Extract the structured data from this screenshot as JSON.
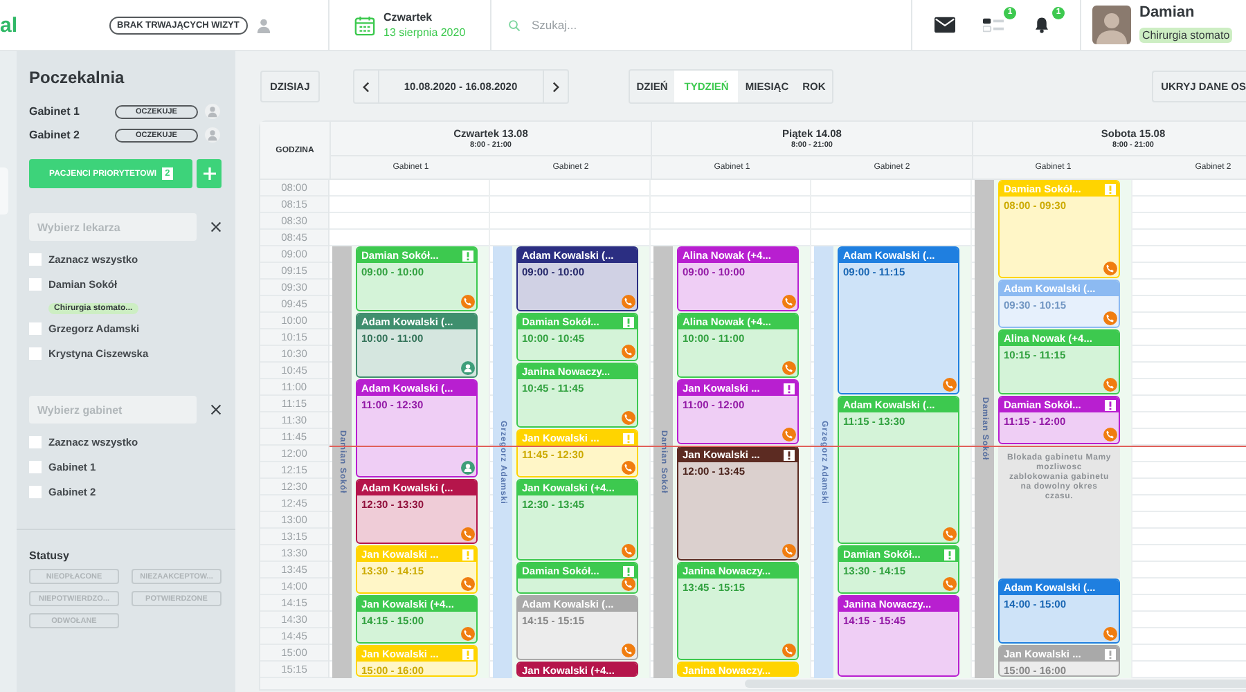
{
  "topbar": {
    "logo": "al",
    "visit_status": "BRAK TRWAJĄCYCH WIZYT",
    "weekday": "Czwartek",
    "date": "13 sierpnia 2020",
    "search": {
      "placeholder": "Szukaj..."
    },
    "tasks_badge": "1",
    "notifications_badge": "1",
    "user": {
      "name": "Damian",
      "specialty": "Chirurgia stomato"
    }
  },
  "sidebar": {
    "title": "Poczekalnia",
    "waiting": [
      {
        "room": "Gabinet 1",
        "status": "OCZEKUJE"
      },
      {
        "room": "Gabinet 2",
        "status": "OCZEKUJE"
      }
    ],
    "priority_button": {
      "label": "PACJENCI PRIORYTETOWI",
      "count": "2"
    },
    "doctor_filter": {
      "placeholder": "Wybierz lekarza",
      "options": [
        {
          "label": "Zaznacz wszystko",
          "checked": false
        },
        {
          "label": "Damian Sokół",
          "tag": "Chirurgia stomato...",
          "checked": false
        },
        {
          "label": "Grzegorz Adamski",
          "checked": false
        },
        {
          "label": "Krystyna Ciszewska",
          "checked": false
        }
      ]
    },
    "room_filter": {
      "placeholder": "Wybierz gabinet",
      "options": [
        {
          "label": "Zaznacz wszystko",
          "checked": false
        },
        {
          "label": "Gabinet 1",
          "checked": false
        },
        {
          "label": "Gabinet 2",
          "checked": false
        }
      ]
    },
    "statuses_title": "Statusy",
    "statuses": [
      {
        "label": "NIEOPŁACONE",
        "selected": false
      },
      {
        "label": "NIEZAAKCEPTOW...",
        "selected": false
      },
      {
        "label": "NIEPOTWIERDZO...",
        "selected": false
      },
      {
        "label": "POTWIERDZONE",
        "selected": false
      },
      {
        "label": "ODWOŁANE",
        "selected": false
      }
    ]
  },
  "toolbar": {
    "today": "DZISIAJ",
    "range": "10.08.2020 - 16.08.2020",
    "views": [
      {
        "label": "DZIEŃ",
        "selected": false
      },
      {
        "label": "TYDZIEŃ",
        "selected": true
      },
      {
        "label": "MIESIĄC",
        "selected": false
      },
      {
        "label": "ROK",
        "selected": false
      }
    ],
    "hide_button": "UKRYJ DANE OS"
  },
  "calendar": {
    "time_heading": "GODZINA",
    "times": [
      "08:00",
      "08:15",
      "08:30",
      "08:45",
      "09:00",
      "09:15",
      "09:30",
      "09:45",
      "10:00",
      "10:15",
      "10:30",
      "10:45",
      "11:00",
      "11:15",
      "11:30",
      "11:45",
      "12:00",
      "12:15",
      "12:30",
      "12:45",
      "13:00",
      "13:15",
      "13:30",
      "13:45",
      "14:00",
      "14:15",
      "14:30",
      "14:45",
      "15:00",
      "15:15"
    ],
    "days": [
      {
        "title": "Czwartek 13.08",
        "hours": "8:00 - 21:00",
        "rooms": [
          {
            "label": "Gabinet 1",
            "doctor": "Damian Sokół",
            "color": "#c4c4c4",
            "events": [
              {
                "kind": "phone",
                "patient": "Damian Sokół...",
                "time": "09:00 - 10:00",
                "color": "#3dc94f",
                "flag": true
              },
              {
                "kind": "person",
                "patient": "Adam Kowalski (...",
                "time": "10:00 - 11:00",
                "color": "#3f8f6e",
                "flag": false
              },
              {
                "kind": "person",
                "patient": "Adam Kowalski (...",
                "time": "11:00 - 12:30",
                "color": "#b81fd0",
                "flag": false
              },
              {
                "kind": "phone",
                "patient": "Adam Kowalski (...",
                "time": "12:30 - 13:30",
                "color": "#b5154b",
                "flag": false
              },
              {
                "kind": "phone",
                "patient": "Jan Kowalski ...",
                "time": "13:30 - 14:15",
                "color": "#ffd400",
                "flag": true
              },
              {
                "kind": "phone",
                "patient": "Jan Kowalski (+4...",
                "time": "14:15 - 15:00",
                "color": "#3dc94f",
                "flag": false
              },
              {
                "kind": "plain",
                "patient": "Jan Kowalski ...",
                "time": "15:00 - 16:00",
                "color": "#ffd400",
                "flag": true
              }
            ]
          },
          {
            "label": "Gabinet 2",
            "doctor": "Grzegorz Adamski",
            "color": "#cde1f7",
            "events": [
              {
                "kind": "phone",
                "patient": "Adam Kowalski (...",
                "time": "09:00 - 10:00",
                "color": "#2b2e82",
                "flag": false
              },
              {
                "kind": "phone",
                "patient": "Damian Sokół...",
                "time": "10:00 - 10:45",
                "color": "#3dc94f",
                "flag": true
              },
              {
                "kind": "phone",
                "patient": "Janina Nowaczy...",
                "time": "10:45 - 11:45",
                "color": "#3dc94f",
                "flag": false
              },
              {
                "kind": "phone",
                "patient": "Jan Kowalski ...",
                "time": "11:45 - 12:30",
                "color": "#ffd400",
                "flag": true
              },
              {
                "kind": "phone",
                "patient": "Jan Kowalski (+4...",
                "time": "12:30 - 13:45",
                "color": "#3dc94f",
                "flag": false
              },
              {
                "kind": "phone",
                "patient": "Damian Sokół...",
                "color": "#3dc94f",
                "flag": true
              },
              {
                "kind": "phone",
                "patient": "Adam Kowalski (...",
                "time": "14:15 - 15:15",
                "color": "#a9a9a9",
                "flag": false
              },
              {
                "kind": "plain",
                "patient": "Jan Kowalski (+4...",
                "color": "#b5154b",
                "flag": false
              }
            ]
          }
        ]
      },
      {
        "title": "Piątek 14.08",
        "hours": "8:00 - 21:00",
        "rooms": [
          {
            "label": "Gabinet 1",
            "doctor": "Damian Sokół",
            "color": "#c4c4c4",
            "events": [
              {
                "kind": "phone",
                "patient": "Alina Nowak (+4...",
                "time": "09:00 - 10:00",
                "color": "#b81fd0",
                "flag": false
              },
              {
                "kind": "phone",
                "patient": "Alina Nowak (+4...",
                "time": "10:00 - 11:00",
                "color": "#3dc94f",
                "flag": false
              },
              {
                "kind": "phone",
                "patient": "Jan Kowalski ...",
                "time": "11:00 - 12:00",
                "color": "#b81fd0",
                "flag": true
              },
              {
                "kind": "phone",
                "patient": "Jan Kowalski ...",
                "time": "12:00 - 13:45",
                "color": "#5c2b22",
                "flag": true
              },
              {
                "kind": "phone",
                "patient": "Janina Nowaczy...",
                "time": "13:45 - 15:15",
                "color": "#3dc94f",
                "flag": false
              },
              {
                "kind": "plain",
                "patient": "Janina Nowaczy...",
                "color": "#ffd400",
                "flag": false
              }
            ]
          },
          {
            "label": "Gabinet 2",
            "doctor": "Grzegorz Adamski",
            "color": "#cde1f7",
            "events": [
              {
                "kind": "phone",
                "patient": "Adam Kowalski (...",
                "time": "09:00 - 11:15",
                "color": "#1f7fe0",
                "flag": false
              },
              {
                "kind": "phone",
                "patient": "Adam Kowalski (...",
                "time": "11:15 - 13:30",
                "color": "#3dc94f",
                "flag": false
              },
              {
                "kind": "phone",
                "patient": "Damian Sokół...",
                "time": "13:30 - 14:15",
                "color": "#3dc94f",
                "flag": true
              },
              {
                "kind": "plain",
                "patient": "Janina Nowaczy...",
                "time": "14:15 - 15:45",
                "color": "#b81fd0",
                "flag": false
              }
            ]
          }
        ]
      },
      {
        "title": "Sobota 15.08",
        "hours": "8:00 - 21:00",
        "rooms": [
          {
            "label": "Gabinet 1",
            "doctor": "Damian Sokół",
            "color": "#c4c4c4",
            "events": [
              {
                "kind": "phone",
                "patient": "Damian Sokół...",
                "time": "08:00 - 09:30",
                "color": "#ffd400",
                "flag": true
              },
              {
                "kind": "phone",
                "patient": "Adam Kowalski (...",
                "time": "09:30 - 10:15",
                "color": "#8cbaf2",
                "flag": false
              },
              {
                "kind": "phone",
                "patient": "Alina Nowak (+4...",
                "time": "10:15 - 11:15",
                "color": "#3dc94f",
                "flag": false
              },
              {
                "kind": "phone",
                "patient": "Damian Sokół...",
                "time": "11:15 - 12:00",
                "color": "#b81fd0",
                "flag": true
              },
              {
                "kind": "block",
                "text": "Blokada gabinetu Mamy mozliwosc zablokowania gabinetu na dowolny okres czasu."
              },
              {
                "kind": "phone",
                "patient": "Adam Kowalski (...",
                "time": "14:00 - 15:00",
                "color": "#1f7fe0",
                "flag": false
              },
              {
                "kind": "plain",
                "patient": "Jan Kowalski ...",
                "time": "15:00 - 16:00",
                "color": "#a9a9a9",
                "flag": true
              }
            ]
          },
          {
            "label": "Gabinet 2"
          }
        ]
      }
    ]
  }
}
